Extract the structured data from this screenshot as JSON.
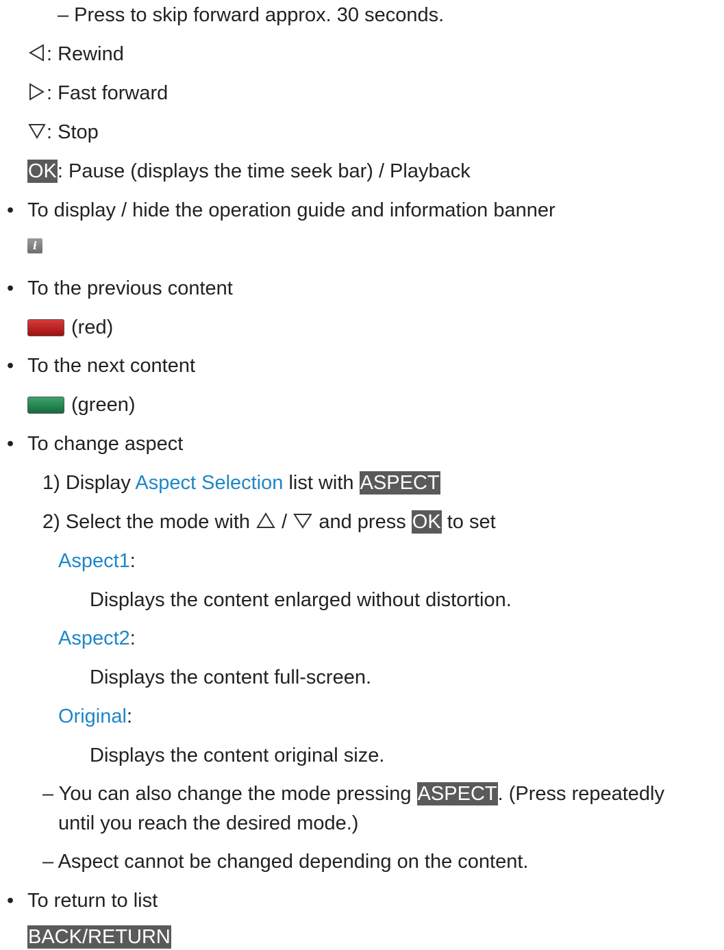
{
  "top": {
    "skip": "–  Press to skip forward approx. 30 seconds.",
    "rewind": ": Rewind",
    "fast_forward": ": Fast forward",
    "stop": ": Stop",
    "ok_key": "OK",
    "pause": ": Pause (displays the time seek bar) / Playback"
  },
  "info_section": {
    "bullet": "•",
    "text": "To display / hide the operation guide and information banner",
    "icon_glyph": "i"
  },
  "previous_section": {
    "bullet": "•",
    "text": "To the previous content",
    "button_label": "(red)"
  },
  "next_section": {
    "bullet": "•",
    "text": "To the next content",
    "button_label": "(green)"
  },
  "aspect_section": {
    "bullet": "•",
    "text": "To change aspect",
    "step1_prefix": "1)  Display ",
    "step1_link": "Aspect Selection",
    "step1_mid": " list with ",
    "aspect_key": "ASPECT",
    "step2_prefix": "2)  Select the mode with ",
    "step2_slash": " / ",
    "step2_mid": " and press ",
    "ok_key": "OK",
    "step2_suffix": " to set",
    "modes": [
      {
        "name": "Aspect1",
        "colon": ":",
        "desc": "Displays the content enlarged without distortion."
      },
      {
        "name": "Aspect2",
        "colon": ":",
        "desc": "Displays the content full-screen."
      },
      {
        "name": "Original",
        "colon": ":",
        "desc": "Displays the content original size."
      }
    ],
    "note1_prefix": "–  You can also change the mode pressing ",
    "note1_suffix": ". (Press repeatedly",
    "note1_cont": "until you reach the desired mode.)",
    "note2": "–  Aspect cannot be changed depending on the content."
  },
  "return_section": {
    "bullet": "•",
    "text": "To return to list",
    "key": "BACK/RETURN"
  },
  "colors": {
    "link": "#1e86c8",
    "key_bg": "#5a5a5a",
    "red_button": "#c02020",
    "green_button": "#2a8a55"
  },
  "icons": [
    "rewind-triangle-left-icon",
    "fast-forward-triangle-right-icon",
    "stop-triangle-down-icon",
    "info-icon",
    "red-button-icon",
    "green-button-icon",
    "up-triangle-icon",
    "down-triangle-icon"
  ]
}
